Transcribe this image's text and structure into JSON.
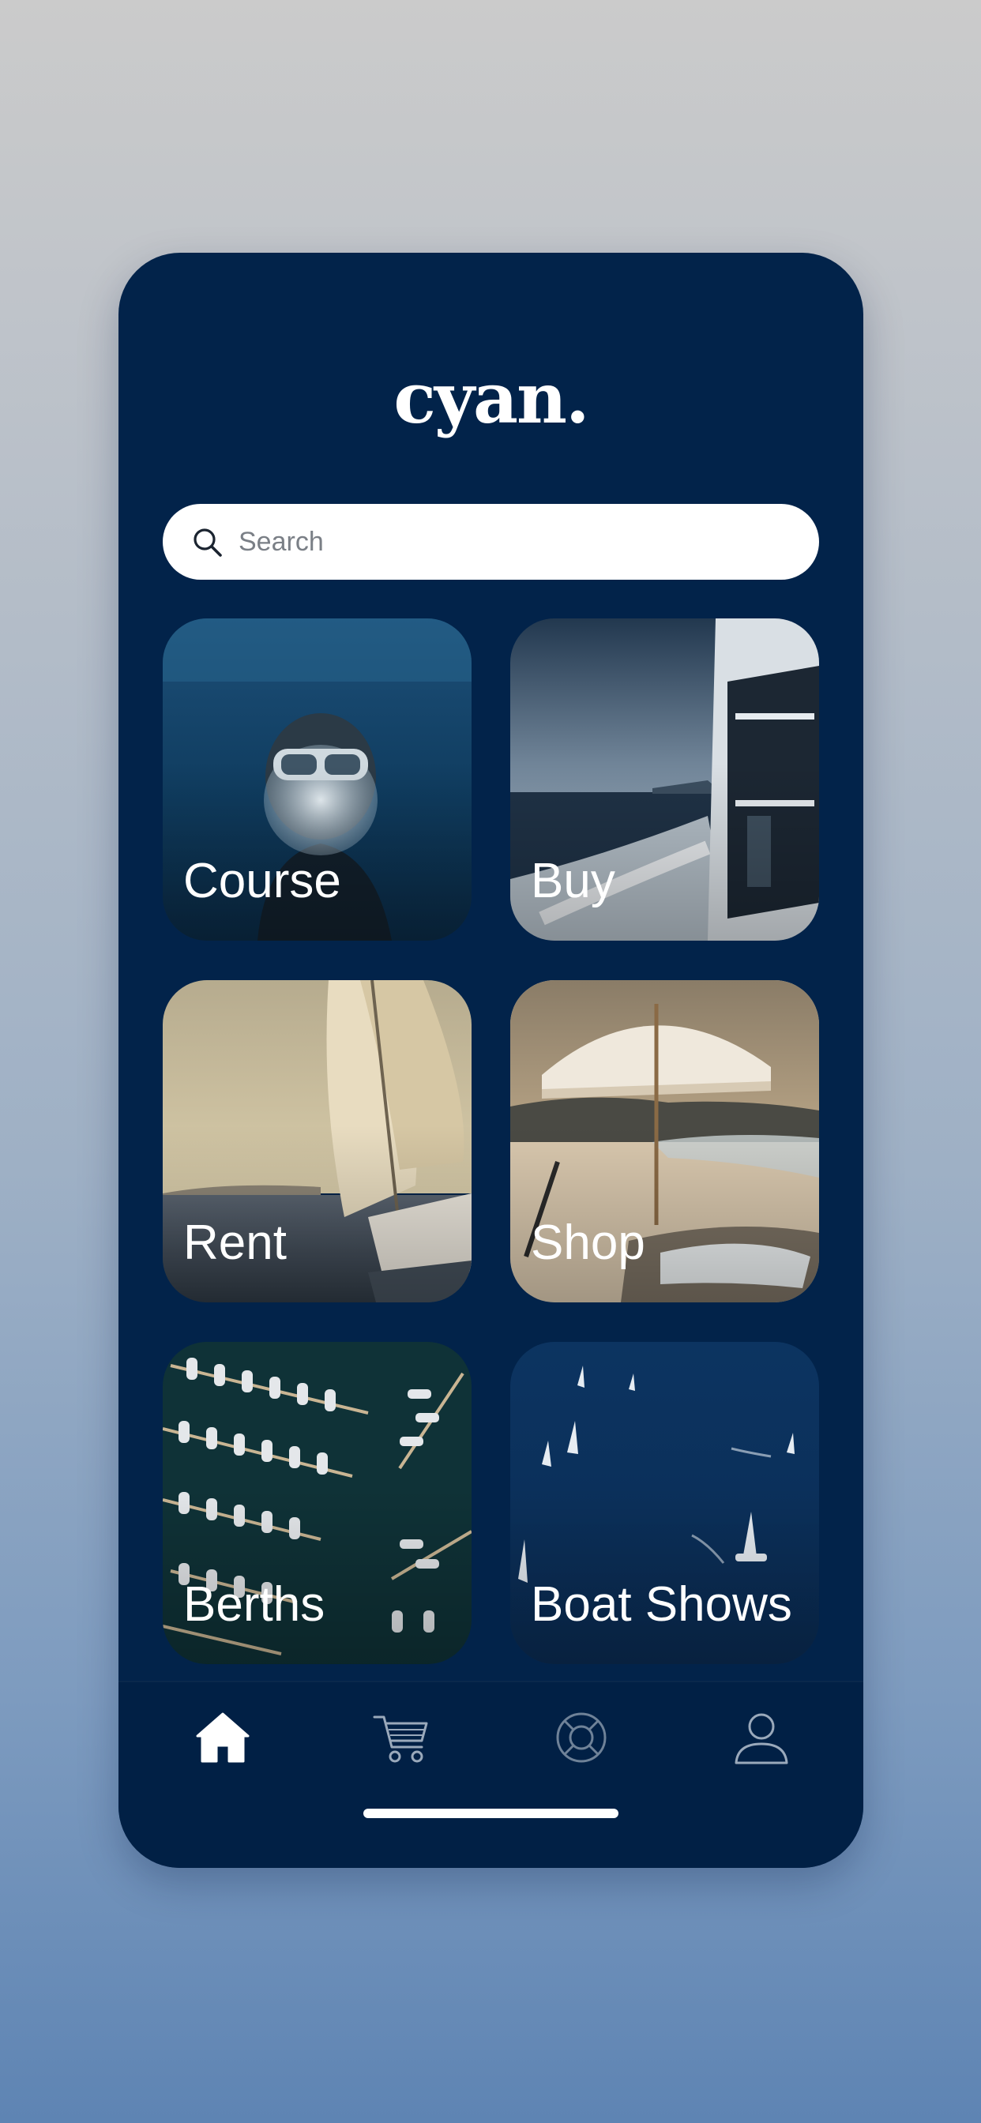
{
  "app": {
    "logo_text": "cyan."
  },
  "search": {
    "placeholder": "Search",
    "icon": "search-icon"
  },
  "tiles": [
    {
      "label": "Course",
      "icon": "diver-photo"
    },
    {
      "label": "Buy",
      "icon": "yacht-photo"
    },
    {
      "label": "Rent",
      "icon": "sailboat-photo"
    },
    {
      "label": "Shop",
      "icon": "beach-umbrella-photo"
    },
    {
      "label": "Berths",
      "icon": "marina-photo"
    },
    {
      "label": "Boat Shows",
      "icon": "sailboats-at-sea-photo"
    }
  ],
  "tabbar": {
    "items": [
      {
        "icon": "home-icon",
        "active": true
      },
      {
        "icon": "cart-icon",
        "active": false
      },
      {
        "icon": "lifebuoy-icon",
        "active": false
      },
      {
        "icon": "profile-icon",
        "active": false
      }
    ]
  },
  "colors": {
    "background_top": "#cbcbcb",
    "background_bottom": "#5e84b3",
    "card": "#02234a",
    "text": "#ffffff",
    "search_field": "#ffffff"
  }
}
